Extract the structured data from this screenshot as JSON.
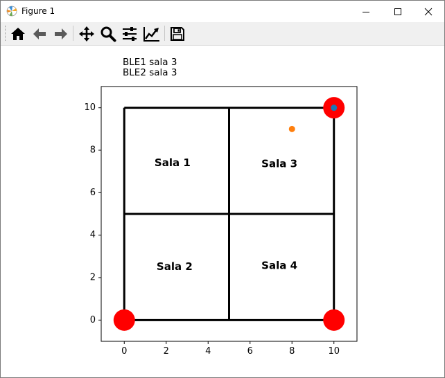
{
  "window": {
    "title": "Figure 1",
    "controls": {
      "minimize": "minimize",
      "maximize": "maximize",
      "close": "close"
    }
  },
  "toolbar": {
    "tools": [
      {
        "id": "home",
        "icon": "home-icon",
        "tooltip": "Reset original view"
      },
      {
        "id": "back",
        "icon": "arrow-left-icon",
        "tooltip": "Back to previous view"
      },
      {
        "id": "forward",
        "icon": "arrow-right-icon",
        "tooltip": "Forward to next view"
      },
      {
        "id": "pan",
        "icon": "move-arrows-icon",
        "tooltip": "Pan axes"
      },
      {
        "id": "zoom",
        "icon": "magnifier-icon",
        "tooltip": "Zoom to rectangle"
      },
      {
        "id": "subplots",
        "icon": "sliders-icon",
        "tooltip": "Configure subplots"
      },
      {
        "id": "customize",
        "icon": "line-chart-icon",
        "tooltip": "Edit axis, curve and image parameters"
      },
      {
        "id": "save",
        "icon": "floppy-disk-icon",
        "tooltip": "Save the figure"
      }
    ]
  },
  "figure_text": [
    "BLE1 sala 3",
    "BLE2 sala 3"
  ],
  "chart_data": {
    "type": "scatter",
    "xlim": [
      -1.1,
      11.1
    ],
    "ylim": [
      -1.0,
      11.0
    ],
    "xticks": [
      0,
      2,
      4,
      6,
      8,
      10
    ],
    "yticks": [
      0,
      2,
      4,
      6,
      8,
      10
    ],
    "grid": false,
    "walls": [
      {
        "x": [
          0,
          10
        ],
        "y": [
          10,
          10
        ]
      },
      {
        "x": [
          0,
          10
        ],
        "y": [
          0,
          0
        ]
      },
      {
        "x": [
          0,
          0
        ],
        "y": [
          0,
          10
        ]
      },
      {
        "x": [
          10,
          10
        ],
        "y": [
          0,
          10
        ]
      },
      {
        "x": [
          5,
          5
        ],
        "y": [
          0,
          10
        ]
      },
      {
        "x": [
          0,
          10
        ],
        "y": [
          5,
          5
        ]
      }
    ],
    "room_labels": [
      {
        "text": "Sala 1",
        "x": 2.3,
        "y": 7.4
      },
      {
        "text": "Sala 2",
        "x": 2.4,
        "y": 2.5
      },
      {
        "text": "Sala 3",
        "x": 7.4,
        "y": 7.35
      },
      {
        "text": "Sala 4",
        "x": 7.4,
        "y": 2.55
      }
    ],
    "anchors": {
      "color": "#ff0000",
      "points": [
        {
          "x": 10,
          "y": 10
        },
        {
          "x": 0,
          "y": 0
        },
        {
          "x": 10,
          "y": 0
        }
      ]
    },
    "series": [
      {
        "color": "#1f77b4",
        "x": [
          10
        ],
        "y": [
          10
        ]
      },
      {
        "color": "#ff7f0e",
        "x": [
          8
        ],
        "y": [
          9
        ]
      }
    ]
  }
}
